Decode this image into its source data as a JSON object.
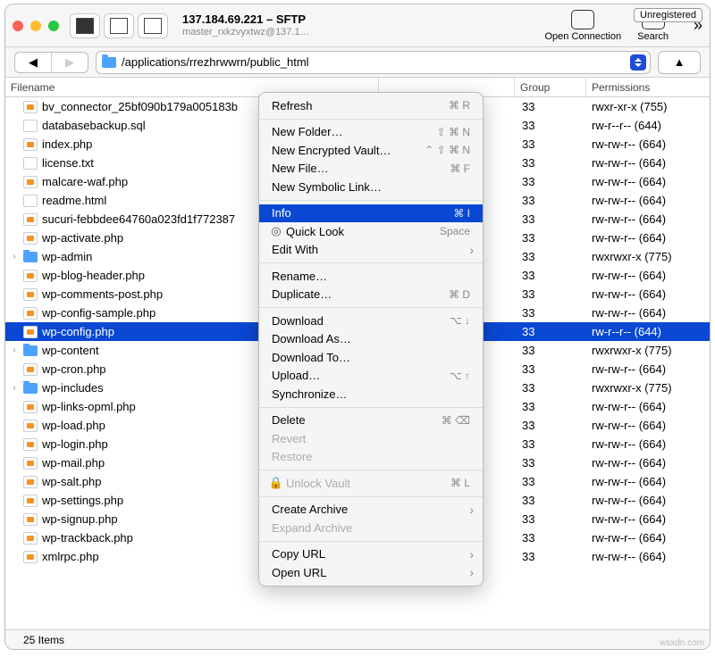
{
  "header": {
    "title": "137.184.69.221 – SFTP",
    "subtitle": "master_rxkzvyxtwz@137.1…",
    "open_conn": "Open Connection",
    "search": "Search",
    "unregistered": "Unregistered"
  },
  "path": "/applications/rrezhrwwrn/public_html",
  "columns": {
    "filename": "Filename",
    "group": "Group",
    "permissions": "Permissions"
  },
  "status": "25 Items",
  "files": [
    {
      "icon": "php",
      "name": "bv_connector_25bf090b179a005183b",
      "group": "33",
      "perm": "rwxr-xr-x (755)"
    },
    {
      "icon": "file",
      "name": "databasebackup.sql",
      "group": "33",
      "perm": "rw-r--r-- (644)"
    },
    {
      "icon": "php",
      "name": "index.php",
      "group": "33",
      "perm": "rw-rw-r-- (664)"
    },
    {
      "icon": "file",
      "name": "license.txt",
      "group": "33",
      "perm": "rw-rw-r-- (664)"
    },
    {
      "icon": "php",
      "name": "malcare-waf.php",
      "group": "33",
      "perm": "rw-rw-r-- (664)"
    },
    {
      "icon": "file",
      "name": "readme.html",
      "group": "33",
      "perm": "rw-rw-r-- (664)"
    },
    {
      "icon": "php",
      "name": "sucuri-febbdee64760a023fd1f772387",
      "group": "33",
      "perm": "rw-rw-r-- (664)"
    },
    {
      "icon": "php",
      "name": "wp-activate.php",
      "group": "33",
      "perm": "rw-rw-r-- (664)"
    },
    {
      "icon": "fold",
      "name": "wp-admin",
      "group": "33",
      "perm": "rwxrwxr-x (775)",
      "exp": true
    },
    {
      "icon": "php",
      "name": "wp-blog-header.php",
      "group": "33",
      "perm": "rw-rw-r-- (664)"
    },
    {
      "icon": "php",
      "name": "wp-comments-post.php",
      "group": "33",
      "perm": "rw-rw-r-- (664)"
    },
    {
      "icon": "php",
      "name": "wp-config-sample.php",
      "group": "33",
      "perm": "rw-rw-r-- (664)"
    },
    {
      "icon": "php",
      "name": "wp-config.php",
      "group": "33",
      "perm": "rw-r--r-- (644)",
      "sel": true
    },
    {
      "icon": "fold",
      "name": "wp-content",
      "group": "33",
      "perm": "rwxrwxr-x (775)",
      "exp": true
    },
    {
      "icon": "php",
      "name": "wp-cron.php",
      "group": "33",
      "perm": "rw-rw-r-- (664)"
    },
    {
      "icon": "fold",
      "name": "wp-includes",
      "group": "33",
      "perm": "rwxrwxr-x (775)",
      "exp": true
    },
    {
      "icon": "php",
      "name": "wp-links-opml.php",
      "group": "33",
      "perm": "rw-rw-r-- (664)"
    },
    {
      "icon": "php",
      "name": "wp-load.php",
      "group": "33",
      "perm": "rw-rw-r-- (664)"
    },
    {
      "icon": "php",
      "name": "wp-login.php",
      "group": "33",
      "perm": "rw-rw-r-- (664)"
    },
    {
      "icon": "php",
      "name": "wp-mail.php",
      "group": "33",
      "perm": "rw-rw-r-- (664)"
    },
    {
      "icon": "php",
      "name": "wp-salt.php",
      "group": "33",
      "perm": "rw-rw-r-- (664)"
    },
    {
      "icon": "php",
      "name": "wp-settings.php",
      "group": "33",
      "perm": "rw-rw-r-- (664)"
    },
    {
      "icon": "php",
      "name": "wp-signup.php",
      "group": "33",
      "perm": "rw-rw-r-- (664)"
    },
    {
      "icon": "php",
      "name": "wp-trackback.php",
      "group": "33",
      "perm": "rw-rw-r-- (664)"
    },
    {
      "icon": "php",
      "name": "xmlrpc.php",
      "group": "33",
      "perm": "rw-rw-r-- (664)"
    }
  ],
  "menu": [
    {
      "t": "item",
      "label": "Refresh",
      "sc": "⌘ R"
    },
    {
      "t": "sep"
    },
    {
      "t": "item",
      "label": "New Folder…",
      "sc": "⇧ ⌘ N"
    },
    {
      "t": "item",
      "label": "New Encrypted Vault…",
      "sc": "⌃ ⇧ ⌘ N"
    },
    {
      "t": "item",
      "label": "New File…",
      "sc": "⌘ F"
    },
    {
      "t": "item",
      "label": "New Symbolic Link…"
    },
    {
      "t": "sep"
    },
    {
      "t": "item",
      "label": "Info",
      "sc": "⌘ I",
      "hl": true
    },
    {
      "t": "item",
      "label": "Quick Look",
      "sc": "Space",
      "pre": "◎"
    },
    {
      "t": "item",
      "label": "Edit With",
      "sub": true
    },
    {
      "t": "sep"
    },
    {
      "t": "item",
      "label": "Rename…"
    },
    {
      "t": "item",
      "label": "Duplicate…",
      "sc": "⌘ D"
    },
    {
      "t": "sep"
    },
    {
      "t": "item",
      "label": "Download",
      "sc": "⌥ ↓"
    },
    {
      "t": "item",
      "label": "Download As…"
    },
    {
      "t": "item",
      "label": "Download To…"
    },
    {
      "t": "item",
      "label": "Upload…",
      "sc": "⌥ ↑"
    },
    {
      "t": "item",
      "label": "Synchronize…"
    },
    {
      "t": "sep"
    },
    {
      "t": "item",
      "label": "Delete",
      "sc": "⌘ ⌫"
    },
    {
      "t": "item",
      "label": "Revert",
      "dis": true
    },
    {
      "t": "item",
      "label": "Restore",
      "dis": true
    },
    {
      "t": "sep"
    },
    {
      "t": "item",
      "label": "Unlock Vault",
      "sc": "⌘ L",
      "dis": true,
      "pre": "🔒"
    },
    {
      "t": "sep"
    },
    {
      "t": "item",
      "label": "Create Archive",
      "sub": true
    },
    {
      "t": "item",
      "label": "Expand Archive",
      "dis": true
    },
    {
      "t": "sep"
    },
    {
      "t": "item",
      "label": "Copy URL",
      "sub": true
    },
    {
      "t": "item",
      "label": "Open URL",
      "sub": true
    }
  ]
}
